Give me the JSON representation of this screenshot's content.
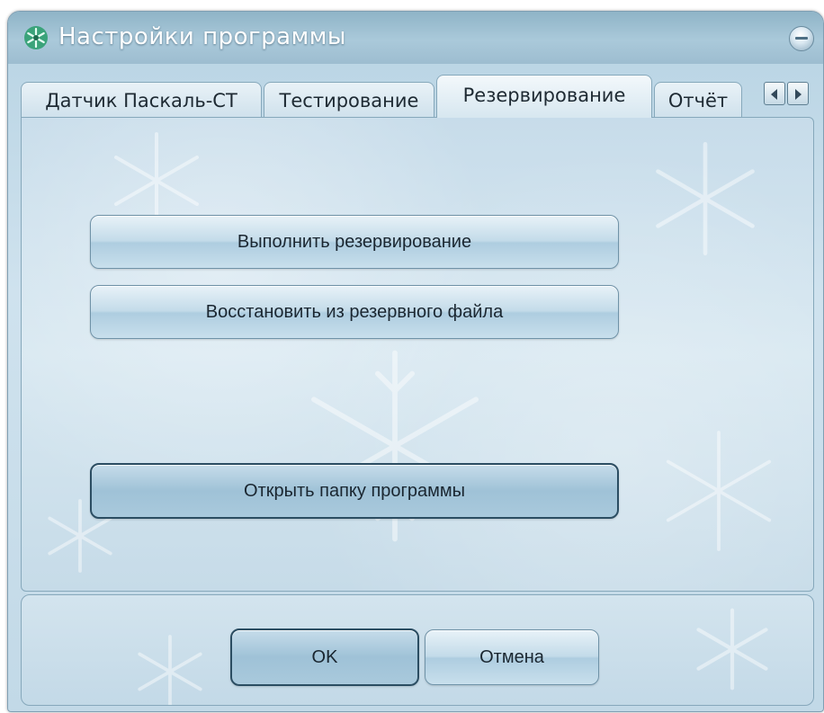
{
  "window": {
    "title": "Настройки программы"
  },
  "tabs": [
    {
      "label": "Датчик Паскаль-СТ",
      "active": false
    },
    {
      "label": "Тестирование",
      "active": false
    },
    {
      "label": "Резервирование",
      "active": true
    },
    {
      "label": "Отчёт",
      "active": false
    }
  ],
  "backup_panel": {
    "do_backup_label": "Выполнить резервирование",
    "restore_label": "Восстановить из резервного файла",
    "open_folder_label": "Открыть папку программы"
  },
  "dialog_buttons": {
    "ok_label": "OK",
    "cancel_label": "Отмена"
  },
  "icons": {
    "title": "snowflake-icon",
    "window_control": "minimize-orb-icon",
    "tab_scroll_left": "arrow-left-icon",
    "tab_scroll_right": "arrow-right-icon"
  },
  "colors": {
    "theme_light": "#d8e8f1",
    "theme_mid": "#aecde0",
    "border": "#6f92a7",
    "title_text": "#ffffff"
  }
}
